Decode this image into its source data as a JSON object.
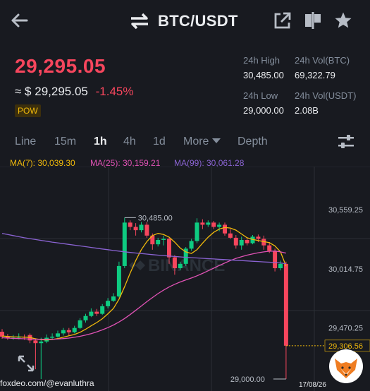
{
  "header": {
    "pair": "BTC/USDT",
    "icons": [
      "back-arrow-icon",
      "swap-arrows-icon",
      "share-icon",
      "split-view-icon",
      "star-icon"
    ]
  },
  "ticker": {
    "last_price": "29,295.05",
    "approx_prefix": "≈ $",
    "approx_value": "29,295.05",
    "change_pct": "-1.45%",
    "tag": "POW",
    "high_label": "24h High",
    "high_value": "30,485.00",
    "vol_btc_label": "24h Vol(BTC)",
    "vol_btc_value": "69,322.79",
    "low_label": "24h Low",
    "low_value": "29,000.00",
    "vol_usdt_label": "24h Vol(USDT)",
    "vol_usdt_value": "2.08B"
  },
  "tabs": {
    "line": "Line",
    "m15": "15m",
    "h1": "1h",
    "h4": "4h",
    "d1": "1d",
    "more": "More",
    "depth": "Depth",
    "active": "1h"
  },
  "ma": {
    "ma7": "MA(7): 30,039.30",
    "ma25": "MA(25): 30,159.21",
    "ma99": "MA(99): 30,061.28"
  },
  "colors": {
    "up": "#0ecb81",
    "down": "#f6465d",
    "ma7": "#f0b90b",
    "ma25": "#e052b5",
    "ma99": "#8a63d2",
    "background": "#181a20"
  },
  "chart_data": {
    "type": "candlestick",
    "y_axis_labels": [
      "30,559.25",
      "30,014.75",
      "29,470.25",
      "29,306.56",
      "29,000.00"
    ],
    "current_price_label": "29,306.56",
    "high_marker": "30,485.00",
    "low_marker": "29,000.00",
    "ylim": [
      28950,
      30600
    ],
    "watermark": "BINANCE",
    "candles": [
      {
        "o": 29435,
        "c": 29390,
        "h": 29460,
        "l": 29370
      },
      {
        "o": 29390,
        "c": 29375,
        "h": 29415,
        "l": 29360
      },
      {
        "o": 29375,
        "c": 29380,
        "h": 29405,
        "l": 29360
      },
      {
        "o": 29380,
        "c": 29390,
        "h": 29420,
        "l": 29365
      },
      {
        "o": 29390,
        "c": 29385,
        "h": 29410,
        "l": 29360
      },
      {
        "o": 29405,
        "c": 29355,
        "h": 29420,
        "l": 29330
      },
      {
        "o": 29355,
        "c": 29330,
        "h": 29375,
        "l": 29090
      },
      {
        "o": 29330,
        "c": 29345,
        "h": 29380,
        "l": 29000
      },
      {
        "o": 29345,
        "c": 29380,
        "h": 29410,
        "l": 29330
      },
      {
        "o": 29380,
        "c": 29390,
        "h": 29420,
        "l": 29370
      },
      {
        "o": 29390,
        "c": 29420,
        "h": 29445,
        "l": 29380
      },
      {
        "o": 29420,
        "c": 29450,
        "h": 29470,
        "l": 29400
      },
      {
        "o": 29450,
        "c": 29430,
        "h": 29470,
        "l": 29400
      },
      {
        "o": 29430,
        "c": 29470,
        "h": 29490,
        "l": 29420
      },
      {
        "o": 29470,
        "c": 29540,
        "h": 29560,
        "l": 29460
      },
      {
        "o": 29540,
        "c": 29580,
        "h": 29600,
        "l": 29520
      },
      {
        "o": 29580,
        "c": 29620,
        "h": 29650,
        "l": 29570
      },
      {
        "o": 29620,
        "c": 29600,
        "h": 29645,
        "l": 29580
      },
      {
        "o": 29600,
        "c": 29670,
        "h": 29690,
        "l": 29590
      },
      {
        "o": 29670,
        "c": 29720,
        "h": 29745,
        "l": 29650
      },
      {
        "o": 29720,
        "c": 29760,
        "h": 29790,
        "l": 29710
      },
      {
        "o": 29760,
        "c": 30040,
        "h": 30080,
        "l": 29750
      },
      {
        "o": 30040,
        "c": 30440,
        "h": 30485,
        "l": 30020
      },
      {
        "o": 30440,
        "c": 30400,
        "h": 30460,
        "l": 30370
      },
      {
        "o": 30400,
        "c": 30370,
        "h": 30435,
        "l": 30320
      },
      {
        "o": 30370,
        "c": 30420,
        "h": 30445,
        "l": 30350
      },
      {
        "o": 30420,
        "c": 30320,
        "h": 30445,
        "l": 30300
      },
      {
        "o": 30320,
        "c": 30240,
        "h": 30340,
        "l": 30190
      },
      {
        "o": 30240,
        "c": 30280,
        "h": 30300,
        "l": 30220
      },
      {
        "o": 30280,
        "c": 30290,
        "h": 30320,
        "l": 30230
      },
      {
        "o": 30290,
        "c": 30120,
        "h": 30300,
        "l": 30060
      },
      {
        "o": 30120,
        "c": 30020,
        "h": 30140,
        "l": 29960
      },
      {
        "o": 30020,
        "c": 30060,
        "h": 30080,
        "l": 30000
      },
      {
        "o": 30060,
        "c": 30200,
        "h": 30215,
        "l": 30040
      },
      {
        "o": 30200,
        "c": 30270,
        "h": 30290,
        "l": 30180
      },
      {
        "o": 30270,
        "c": 30440,
        "h": 30480,
        "l": 30250
      },
      {
        "o": 30440,
        "c": 30420,
        "h": 30470,
        "l": 30380
      },
      {
        "o": 30420,
        "c": 30440,
        "h": 30460,
        "l": 30400
      },
      {
        "o": 30440,
        "c": 30400,
        "h": 30455,
        "l": 30380
      },
      {
        "o": 30400,
        "c": 30420,
        "h": 30440,
        "l": 30360
      },
      {
        "o": 30420,
        "c": 30340,
        "h": 30440,
        "l": 30320
      },
      {
        "o": 30340,
        "c": 30300,
        "h": 30380,
        "l": 30290
      },
      {
        "o": 30300,
        "c": 30230,
        "h": 30325,
        "l": 30200
      },
      {
        "o": 30230,
        "c": 30280,
        "h": 30310,
        "l": 30190
      },
      {
        "o": 30280,
        "c": 30250,
        "h": 30300,
        "l": 30230
      },
      {
        "o": 30250,
        "c": 30310,
        "h": 30325,
        "l": 30240
      },
      {
        "o": 30310,
        "c": 30290,
        "h": 30330,
        "l": 30260
      },
      {
        "o": 30290,
        "c": 30230,
        "h": 30320,
        "l": 30190
      },
      {
        "o": 30230,
        "c": 30180,
        "h": 30260,
        "l": 30160
      },
      {
        "o": 30180,
        "c": 30020,
        "h": 30200,
        "l": 29990
      },
      {
        "o": 30020,
        "c": 30060,
        "h": 30090,
        "l": 30000
      },
      {
        "o": 30060,
        "c": 29306.56,
        "h": 30080,
        "l": 29000
      }
    ],
    "ma_series": [
      {
        "name": "MA(7)",
        "values": [
          29395,
          29392,
          29388,
          29387,
          29386,
          29382,
          29370,
          29362,
          29360,
          29363,
          29372,
          29385,
          29398,
          29410,
          29430,
          29458,
          29490,
          29520,
          29555,
          29600,
          29650,
          29735,
          29850,
          29975,
          30090,
          30190,
          30265,
          30320,
          30340,
          30330,
          30305,
          30260,
          30205,
          30170,
          30155,
          30190,
          30250,
          30305,
          30350,
          30380,
          30395,
          30390,
          30370,
          30335,
          30300,
          30285,
          30275,
          30265,
          30255,
          30225,
          30170,
          30039.3
        ]
      },
      {
        "name": "MA(25)",
        "values": [
          29380,
          29377,
          29374,
          29372,
          29370,
          29368,
          29366,
          29365,
          29365,
          29366,
          29368,
          29372,
          29377,
          29384,
          29393,
          29404,
          29418,
          29434,
          29452,
          29473,
          29497,
          29525,
          29557,
          29593,
          29632,
          29672,
          29712,
          29750,
          29786,
          29818,
          29847,
          29872,
          29893,
          29912,
          29930,
          29950,
          29972,
          29996,
          30020,
          30045,
          30068,
          30090,
          30110,
          30126,
          30140,
          30152,
          30162,
          30170,
          30176,
          30178,
          30170,
          30159.21
        ]
      },
      {
        "name": "MA(99)",
        "values": [
          30340,
          30330,
          30320,
          30310,
          30300,
          30292,
          30284,
          30276,
          30268,
          30260,
          30253,
          30246,
          30239,
          30232,
          30225,
          30218,
          30211,
          30204,
          30197,
          30190,
          30183,
          30177,
          30171,
          30165,
          30160,
          30155,
          30150,
          30145,
          30140,
          30136,
          30132,
          30128,
          30124,
          30120,
          30117,
          30114,
          30111,
          30108,
          30105,
          30102,
          30099,
          30096,
          30093,
          30090,
          30087,
          30084,
          30081,
          30078,
          30075,
          30072,
          30068,
          30061.28
        ]
      }
    ]
  },
  "footer": {
    "watermark_text": "foxdeo.com/@evanluthra",
    "date": "17/08/26"
  }
}
